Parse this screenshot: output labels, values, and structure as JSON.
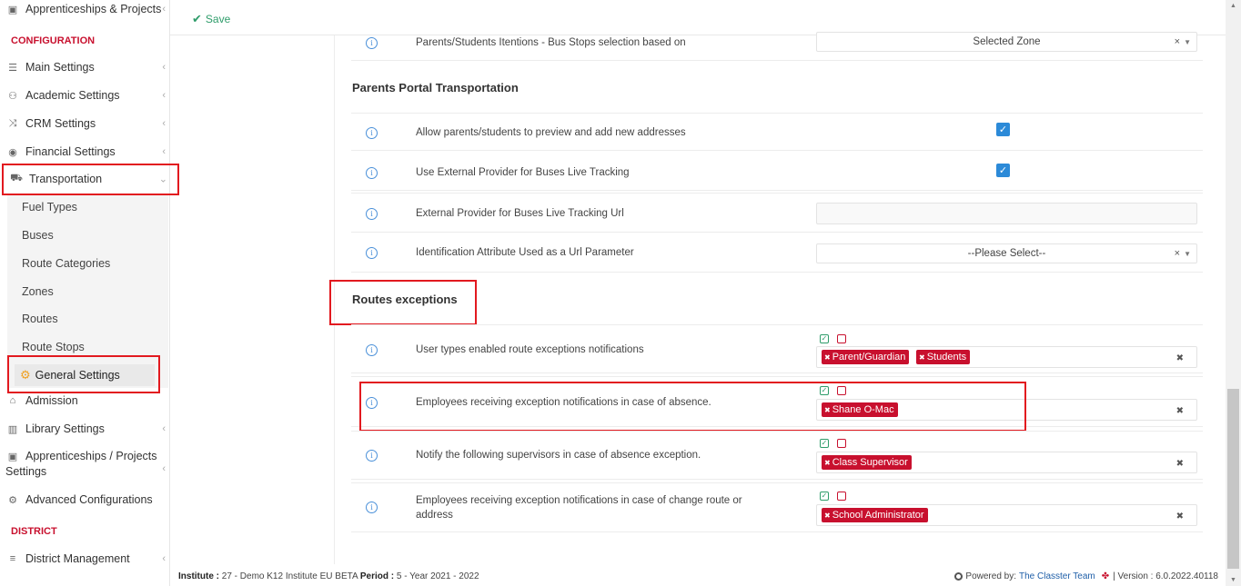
{
  "sidebar": {
    "top_item": {
      "label": "Apprenticeships & Projects",
      "icon": "box-icon"
    },
    "configuration_header": "CONFIGURATION",
    "items": [
      {
        "label": "Main Settings",
        "icon": "sliders-icon"
      },
      {
        "label": "Academic Settings",
        "icon": "people-icon"
      },
      {
        "label": "CRM Settings",
        "icon": "shuffle-icon"
      },
      {
        "label": "Financial Settings",
        "icon": "coins-icon"
      },
      {
        "label": "Transportation",
        "icon": "bus-icon"
      }
    ],
    "transport_sub": [
      "Fuel Types",
      "Buses",
      "Route Categories",
      "Zones",
      "Routes",
      "Route Stops"
    ],
    "active_sub": "General Settings",
    "items_after": [
      {
        "label": "Admission",
        "icon": "bank-icon"
      },
      {
        "label": "Library Settings",
        "icon": "books-icon"
      },
      {
        "label": "Apprenticeships / Projects",
        "label2": "Settings",
        "icon": "box-icon"
      },
      {
        "label": "Advanced Configurations",
        "icon": "gears-icon"
      }
    ],
    "district_header": "DISTRICT",
    "district_item": {
      "label": "District Management",
      "icon": "menu-icon"
    }
  },
  "toolbar": {
    "save_label": "Save"
  },
  "settings": {
    "bus_stops": {
      "label": "Parents/Students Itentions - Bus Stops selection based on",
      "value": "Selected Zone"
    },
    "portal_title": "Parents Portal Transportation",
    "preview_addresses": {
      "label": "Allow parents/students to preview and add new addresses",
      "checked": true
    },
    "external_provider": {
      "label": "Use External Provider for Buses Live Tracking",
      "checked": true
    },
    "tracking_url": {
      "label": "External Provider for Buses Live Tracking Url",
      "value": ""
    },
    "id_attribute": {
      "label": "Identification Attribute Used as a Url Parameter",
      "value": "--Please Select--"
    },
    "exceptions_title": "Routes exceptions",
    "user_types": {
      "label": "User types enabled route exceptions notifications",
      "tags": [
        "Parent/Guardian",
        "Students"
      ]
    },
    "absence_employees": {
      "label": "Employees receiving exception notifications in case of absence.",
      "tags": [
        "Shane O-Mac"
      ]
    },
    "supervisors": {
      "label": "Notify the following supervisors in case of absence exception.",
      "tags": [
        "Class Supervisor"
      ]
    },
    "change_route": {
      "label": "Employees receiving exception notifications in case of change route or address",
      "tags": [
        "School Administrator"
      ]
    }
  },
  "footer": {
    "institute_label": "Institute :",
    "institute_value": "27 - Demo K12 Institute EU BETA",
    "period_label": "Period :",
    "period_value": "5 - Year 2021 - 2022",
    "powered_by": "Powered by:",
    "team": "The Classter Team",
    "version": "| Version : 6.0.2022.40118"
  },
  "colors": {
    "accent_red": "#c8102e",
    "highlight": "#e2191f",
    "save_green": "#2e9c6a",
    "checkbox_blue": "#2c8ad8"
  }
}
